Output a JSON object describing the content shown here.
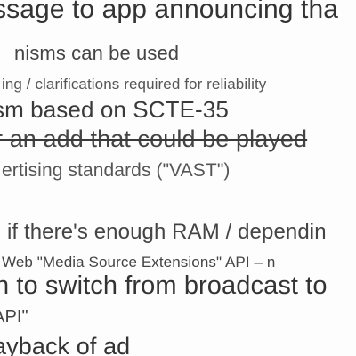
{
  "document": {
    "lines": [
      "ssage to app announcing tha",
      "nisms can be used",
      "ing / clarifications required for reliability",
      "sm based on SCTE-35",
      "r an add that could be played",
      "ertising standards (\"VAST\")",
      "if there's enough RAM / dependin",
      "Web \"Media Source Extensions\" API – n",
      "n to switch from broadcast to",
      "API\"",
      "ayback of ad"
    ]
  }
}
